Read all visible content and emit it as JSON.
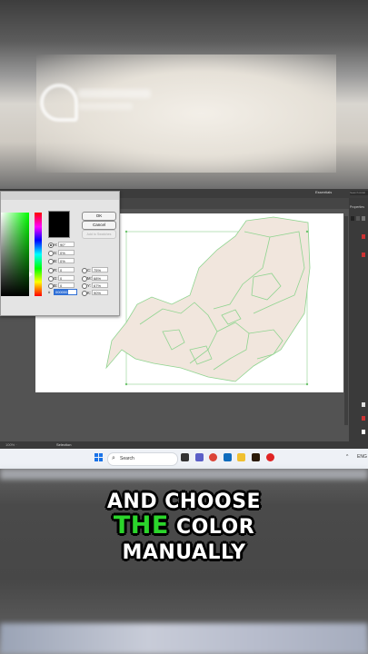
{
  "photoshop": {
    "workspace_label": "Essentials",
    "stock_search": "Search Adob",
    "panel_title": "Properties",
    "status_tool": "Selection",
    "status_left": "100% ·"
  },
  "color_picker": {
    "ok_label": "OK",
    "cancel_label": "Cancel",
    "add_swatches_label": "Add to Swatches",
    "fields": [
      {
        "label": "H:",
        "value": "90°",
        "selected": true
      },
      {
        "label": "S:",
        "value": "0%",
        "selected": false
      },
      {
        "label": "B:",
        "value": "0%",
        "selected": false
      },
      {
        "label": "R:",
        "value": "0",
        "selected": false
      },
      {
        "label": "G:",
        "value": "0",
        "selected": false
      },
      {
        "label": "B:",
        "value": "0",
        "selected": false
      }
    ],
    "cmyk": [
      {
        "label": "C:",
        "value": "75%"
      },
      {
        "label": "M:",
        "value": "68%"
      },
      {
        "label": "Y:",
        "value": "67%"
      },
      {
        "label": "K:",
        "value": "90%"
      }
    ],
    "hex_label": "#",
    "hex_value": "000000",
    "current_color": "#000000"
  },
  "taskbar": {
    "search_placeholder": "Search",
    "tray_arrow": "^",
    "tray_lang": "ENG"
  },
  "caption": {
    "line1": "AND CHOOSE",
    "line2_highlight": "THE",
    "line2_rest": "COLOR",
    "line3": "MANUALLY",
    "highlight_color": "#2bd52b"
  },
  "colors": {
    "shape_fill": "#f1e6dd",
    "shape_stroke": "#8fd48f"
  }
}
